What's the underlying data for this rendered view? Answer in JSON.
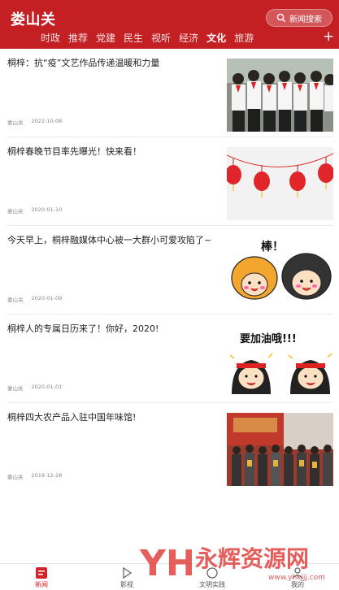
{
  "header": {
    "app_title": "娄山关",
    "search_label": "新闻搜索",
    "tabs": [
      "时政",
      "推荐",
      "党建",
      "民生",
      "视听",
      "经济",
      "文化",
      "旅游"
    ],
    "active_tab": "文化",
    "plus_label": "+"
  },
  "articles": [
    {
      "title": "桐梓：抗“疫”文艺作品传递温暖和力量",
      "source": "娄山关",
      "date": "2022-10-08",
      "thumb": "children-photo"
    },
    {
      "title": "桐梓春晚节目率先曝光！快来看！",
      "source": "娄山关",
      "date": "2020-01-10",
      "thumb": "red-lanterns"
    },
    {
      "title": "今天早上，桐梓融媒体中心被一大群小可爱攻陷了~",
      "source": "娄山关",
      "date": "2020-01-09",
      "thumb": "cartoon-dogs-girls",
      "thumb_text": "棒！"
    },
    {
      "title": "桐梓人的专属日历来了！你好，2020!",
      "source": "娄山关",
      "date": "2020-01-01",
      "thumb": "cartoon-cheer",
      "thumb_text": "要加油哦!!!"
    },
    {
      "title": "桐梓四大农产品入驻中国年味馆!",
      "source": "娄山关",
      "date": "2019-12-28",
      "thumb": "group-photo"
    }
  ],
  "bottom_nav": [
    {
      "label": "新闻",
      "icon": "news-icon",
      "active": true
    },
    {
      "label": "影视",
      "icon": "play-icon",
      "active": false
    },
    {
      "label": "文明实践",
      "icon": "practice-icon",
      "active": false
    },
    {
      "label": "我的",
      "icon": "profile-icon",
      "active": false
    }
  ],
  "watermark": {
    "text": "永辉资源网",
    "url": "www.yhkjjj.com",
    "logo": "YH"
  },
  "colors": {
    "brand_red": "#c41f23",
    "active_nav": "#d0262b"
  }
}
